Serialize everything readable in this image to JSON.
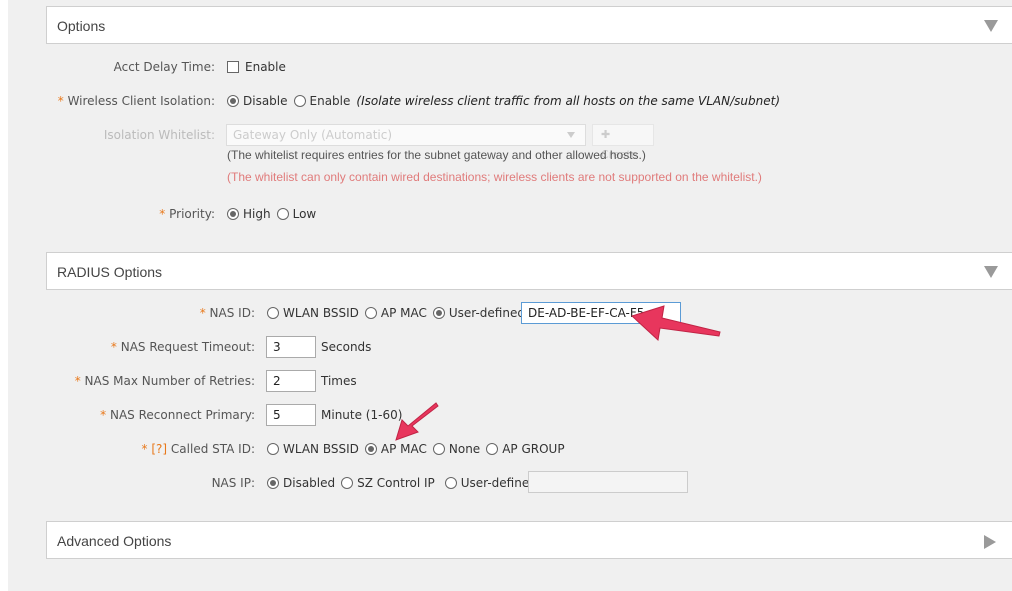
{
  "options_panel": {
    "title": "Options"
  },
  "acct_delay": {
    "label": "Acct Delay Time:",
    "option": "Enable"
  },
  "client_isolation": {
    "required": "*",
    "label": "Wireless Client Isolation:",
    "disable": "Disable",
    "enable": "Enable",
    "hint": "(Isolate wireless client traffic from all hosts on the same VLAN/subnet)",
    "selected": "Disable"
  },
  "isolation_whitelist": {
    "label": "Isolation Whitelist:",
    "value": "Gateway Only (Automatic)",
    "create_label": "Create",
    "note1": "(The whitelist requires entries for the subnet gateway and other allowed hosts.)",
    "note2": "(The whitelist can only contain wired destinations; wireless clients are not supported on the whitelist.)"
  },
  "priority": {
    "required": "*",
    "label": "Priority:",
    "high": "High",
    "low": "Low",
    "selected": "High"
  },
  "radius_panel": {
    "title": "RADIUS Options"
  },
  "nas_id": {
    "required": "*",
    "label": "NAS ID:",
    "opt_bssid": "WLAN BSSID",
    "opt_apmac": "AP MAC",
    "opt_user": "User-defined:",
    "selected": "User-defined:",
    "value": "DE-AD-BE-EF-CA-F5"
  },
  "nas_timeout": {
    "required": "*",
    "label": "NAS Request Timeout:",
    "value": "3",
    "unit": "Seconds"
  },
  "nas_retries": {
    "required": "*",
    "label": "NAS Max Number of Retries:",
    "value": "2",
    "unit": "Times"
  },
  "nas_reconnect": {
    "required": "*",
    "label": "NAS Reconnect Primary:",
    "value": "5",
    "unit": "Minute (1-60)"
  },
  "called_sta": {
    "required": "*",
    "help": "[?]",
    "label": "Called STA ID:",
    "opt_bssid": "WLAN BSSID",
    "opt_apmac": "AP MAC",
    "opt_none": "None",
    "opt_apgroup": "AP GROUP",
    "selected": "AP MAC"
  },
  "nas_ip": {
    "label": "NAS IP:",
    "opt_disabled": "Disabled",
    "opt_sz": "SZ Control IP",
    "opt_user": "User-defined:",
    "selected": "Disabled",
    "value": ""
  },
  "advanced_panel": {
    "title": "Advanced Options"
  },
  "colors": {
    "accent_arrow": "#e8365d",
    "required": "#e8781a",
    "warning_note": "#e07b7b"
  }
}
